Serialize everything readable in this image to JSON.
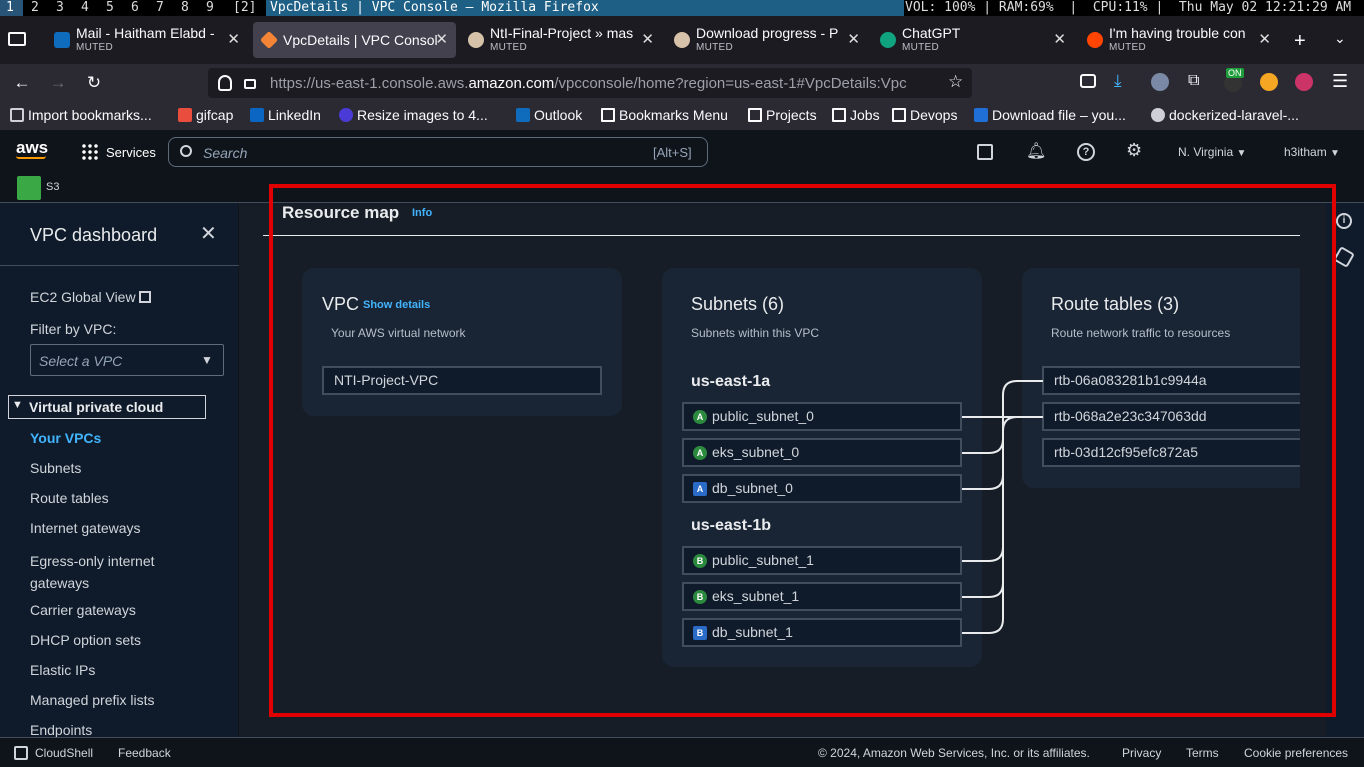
{
  "i3bar": {
    "workspaces": [
      "1",
      "2",
      "3",
      "4",
      "5",
      "6",
      "7",
      "8",
      "9",
      "[2]"
    ],
    "window_title": "VpcDetails | VPC Console — Mozilla Firefox",
    "status": "VOL: 100% | RAM:69%  |  CPU:11% |  Thu May 02 12:21:29 AM"
  },
  "tabs": [
    {
      "title": "Mail - Haitham Elabd -",
      "sub": "MUTED",
      "icon_color": "#0f6cbd"
    },
    {
      "title": "VpcDetails | VPC Console",
      "sub": "",
      "icon_color": "#f58536"
    },
    {
      "title": "NtI-Final-Project » mas",
      "sub": "MUTED",
      "icon_color": "#d6c2a8"
    },
    {
      "title": "Download progress - P",
      "sub": "MUTED",
      "icon_color": "#d6c2a8"
    },
    {
      "title": "ChatGPT",
      "sub": "MUTED",
      "icon_color": "#10a37f"
    },
    {
      "title": "I'm having trouble con",
      "sub": "MUTED",
      "icon_color": "#ff4500"
    }
  ],
  "url": {
    "prefix": "https://us-east-1.console.aws.",
    "domain": "amazon.com",
    "suffix": "/vpcconsole/home?region=us-east-1#VpcDetails:Vpc"
  },
  "extensions": {
    "on_badge": "ON"
  },
  "bookmarks": [
    {
      "label": "Import bookmarks...",
      "icon_color": "#cfcfd8"
    },
    {
      "label": "gifcap",
      "icon_color": "#e84d3d"
    },
    {
      "label": "LinkedIn",
      "icon_color": "#0a66c2"
    },
    {
      "label": "Resize images to 4...",
      "icon_color": "#4b3bd6"
    },
    {
      "label": "Outlook",
      "icon_color": "#0f6cbd"
    },
    {
      "label": "Bookmarks Menu",
      "icon_color": "folder"
    },
    {
      "label": "Projects",
      "icon_color": "folder"
    },
    {
      "label": "Jobs",
      "icon_color": "folder"
    },
    {
      "label": "Devops",
      "icon_color": "folder"
    },
    {
      "label": "Download file – you...",
      "icon_color": "#1f6fd6"
    },
    {
      "label": "dockerized-laravel-...",
      "icon_color": "#cfcfd8"
    }
  ],
  "aws_header": {
    "logo": "aws",
    "services": "Services",
    "search_placeholder": "Search",
    "search_shortcut": "[Alt+S]",
    "region": "N. Virginia",
    "user": "h3itham",
    "favorite": "S3"
  },
  "sidebar": {
    "title": "VPC dashboard",
    "ec2_global": "EC2 Global View",
    "filter_label": "Filter by VPC:",
    "filter_placeholder": "Select a VPC",
    "section": "Virtual private cloud",
    "items": [
      "Your VPCs",
      "Subnets",
      "Route tables",
      "Internet gateways",
      "Egress-only internet gateways",
      "Carrier gateways",
      "DHCP option sets",
      "Elastic IPs",
      "Managed prefix lists",
      "Endpoints"
    ]
  },
  "resource_map": {
    "title": "Resource map",
    "info": "Info",
    "vpc": {
      "title": "VPC",
      "show_details": "Show details",
      "desc": "Your AWS virtual network",
      "name": "NTI-Project-VPC"
    },
    "subnets": {
      "title": "Subnets (6)",
      "desc": "Subnets within this VPC",
      "zones": [
        {
          "name": "us-east-1a",
          "subnets": [
            {
              "badge": "A",
              "name": "public_subnet_0",
              "type": "green"
            },
            {
              "badge": "A",
              "name": "eks_subnet_0",
              "type": "green"
            },
            {
              "badge": "A",
              "name": "db_subnet_0",
              "type": "blue"
            }
          ]
        },
        {
          "name": "us-east-1b",
          "subnets": [
            {
              "badge": "B",
              "name": "public_subnet_1",
              "type": "green"
            },
            {
              "badge": "B",
              "name": "eks_subnet_1",
              "type": "green"
            },
            {
              "badge": "B",
              "name": "db_subnet_1",
              "type": "blue"
            }
          ]
        }
      ]
    },
    "route_tables": {
      "title": "Route tables (3)",
      "desc": "Route network traffic to resources",
      "items": [
        "rtb-06a083281b1c9944a",
        "rtb-068a2e23c347063dd",
        "rtb-03d12cf95efc872a5"
      ]
    }
  },
  "footer": {
    "cloudshell": "CloudShell",
    "feedback": "Feedback",
    "copyright": "© 2024, Amazon Web Services, Inc. or its affiliates.",
    "privacy": "Privacy",
    "terms": "Terms",
    "cookies": "Cookie preferences"
  },
  "highlight_color": "#e00000"
}
